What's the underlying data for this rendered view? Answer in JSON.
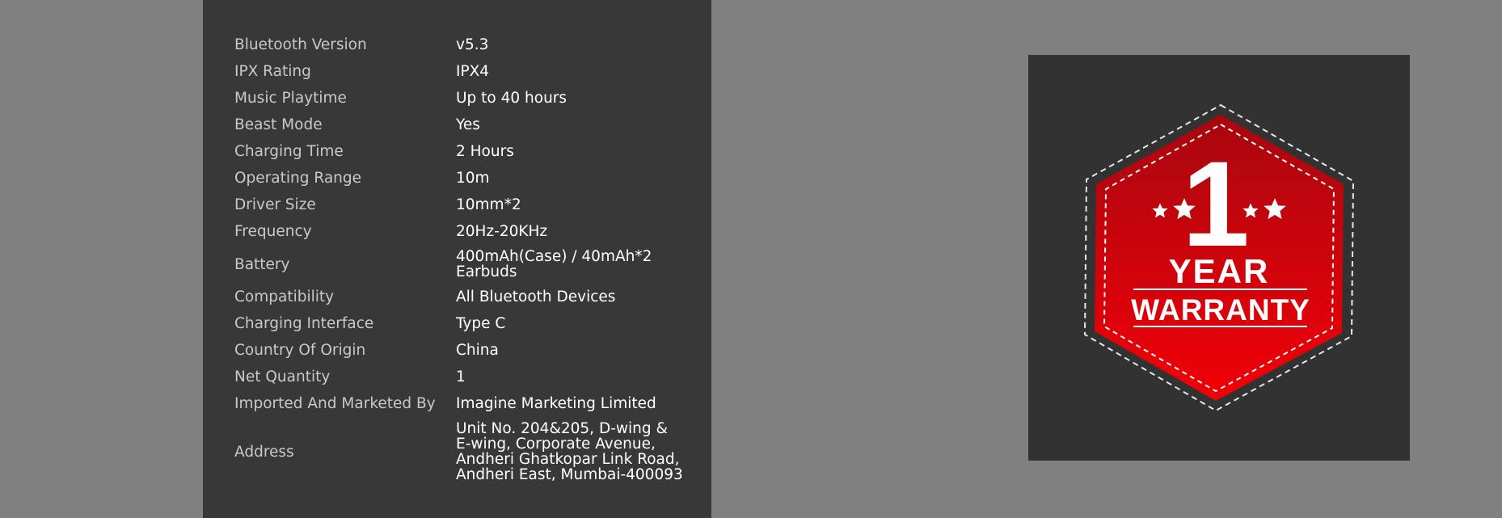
{
  "specs": [
    {
      "label": "Bluetooth Version",
      "value": "v5.3"
    },
    {
      "label": "IPX Rating",
      "value": "IPX4"
    },
    {
      "label": "Music Playtime",
      "value": "Up to 40 hours"
    },
    {
      "label": "Beast Mode",
      "value": "Yes"
    },
    {
      "label": "Charging Time",
      "value": "2 Hours"
    },
    {
      "label": "Operating Range",
      "value": "10m"
    },
    {
      "label": "Driver Size",
      "value": "10mm*2"
    },
    {
      "label": "Frequency",
      "value": "20Hz-20KHz"
    },
    {
      "label": "Battery",
      "value_lines": [
        "400mAh(Case) / 40mAh*2",
        "Earbuds"
      ]
    },
    {
      "label": "Compatibility",
      "value": "All Bluetooth Devices"
    },
    {
      "label": "Charging Interface",
      "value": "Type C"
    },
    {
      "label": "Country Of Origin",
      "value": "China"
    },
    {
      "label": "Net Quantity",
      "value": "1"
    },
    {
      "label": "Imported And Marketed By",
      "value": "Imagine Marketing Limited"
    },
    {
      "label": "Address",
      "value_lines": [
        "Unit No. 204&205, D-wing &",
        "E-wing, Corporate Avenue,",
        "Andheri Ghatkopar Link Road,",
        "Andheri East, Mumbai-400093"
      ]
    }
  ],
  "warranty_badge": {
    "number": "1",
    "line1": "YEAR",
    "line2": "WARRANTY",
    "colors": {
      "badge_red": "#e3000b",
      "badge_dark_red": "#b30710",
      "card_bg": "#323232",
      "stitch": "#ffffff"
    },
    "icons": [
      "star-icon",
      "star-icon",
      "star-icon",
      "star-icon"
    ]
  },
  "colors": {
    "page_bg": "#808080",
    "panel_bg": "#383838",
    "label_text": "#c9c9c9",
    "value_text": "#ffffff"
  }
}
